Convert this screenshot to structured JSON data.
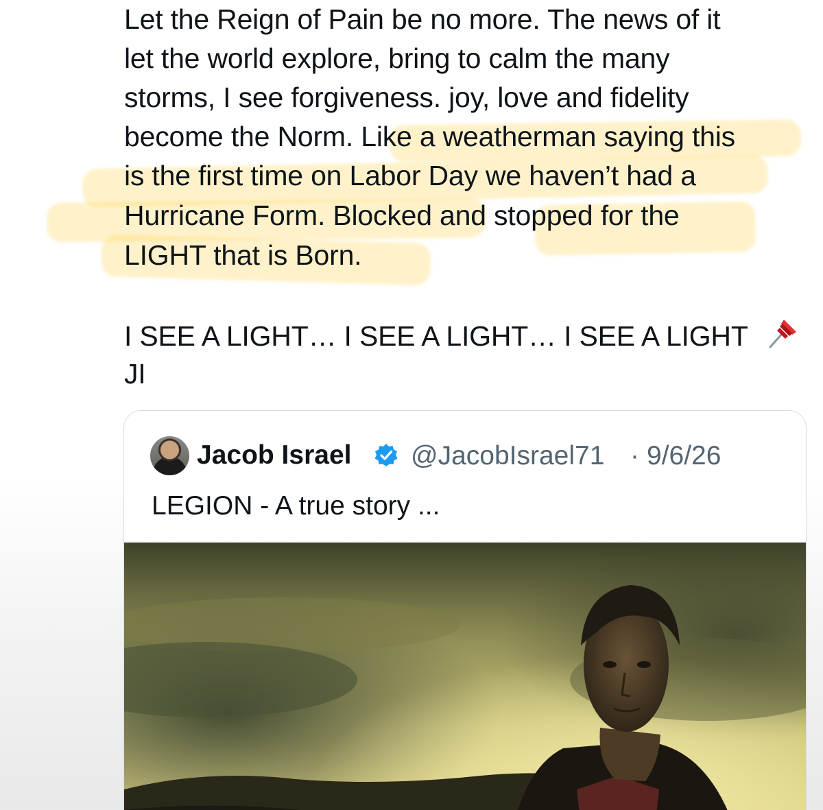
{
  "post": {
    "lines": [
      "Let the Reign of Pain be no more. The news of it",
      "let the world explore, bring to calm the many",
      "storms, I see forgiveness. joy, love and fidelity",
      "become the Norm. Like a weatherman saying this",
      "is the first time on Labor Day we haven’t had a",
      "Hurricane Form. Blocked and stopped for the",
      "LIGHT that is Born."
    ],
    "closing_line": "I SEE A LIGHT… I SEE A LIGHT… I SEE A LIGHT",
    "pin_icon": "pushpin-icon",
    "signature": "JI"
  },
  "quote": {
    "author_name": "Jacob Israel",
    "verified_icon": "verified-badge-icon",
    "handle": "@JacobIsrael71",
    "separator": "·",
    "date": "9/6/26",
    "text": "LEGION - A true story ...",
    "avatar_icon": "avatar"
  },
  "colors": {
    "highlight": "#ffd85c",
    "verified": "#1d9bf0",
    "secondary_text": "#536471",
    "primary_text": "#0f1419"
  }
}
